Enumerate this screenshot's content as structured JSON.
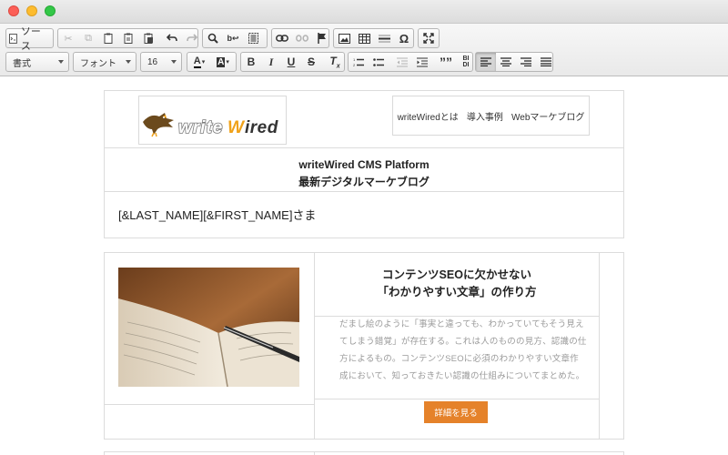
{
  "toolbar": {
    "source_label": "ソース",
    "format_combo": "書式",
    "font_combo": "フォント",
    "size_combo": "16",
    "bold": "B",
    "italic": "I",
    "underline": "U",
    "strike": "S",
    "special_char": "Ω",
    "quote": "””"
  },
  "email": {
    "logo_text": "writeWired",
    "nav": [
      "writeWiredとは",
      "導入事例",
      "Webマーケブログ"
    ],
    "hero_line1": "writeWired CMS Platform",
    "hero_line2": "最新デジタルマーケブログ",
    "greeting": "[&LAST_NAME][&FIRST_NAME]さま",
    "article_title_line1": "コンテンツSEOに欠かせない",
    "article_title_line2": "「わかりやすい文章」の作り方",
    "article_body": "だまし絵のように「事実と違っても、わかっていてもそう見えてしまう錯覚」が存在する。これは人のものの見方、認識の仕方によるもの。コンテンツSEOに必須のわかりやすい文章作成において、知っておきたい認識の仕組みについてまとめた。",
    "more_button": "詳細を見る"
  },
  "colors": {
    "accent": "#e5822a",
    "logo_orange": "#f0a21a",
    "logo_gray": "#7a7a7a"
  }
}
